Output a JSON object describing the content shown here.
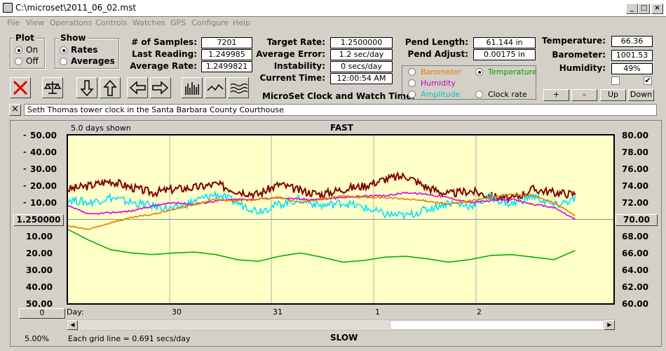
{
  "window": {
    "title": "C:\\microset\\2011_06_02.mst"
  },
  "menu": [
    "File",
    "View",
    "Operations",
    "Controls",
    "Watches",
    "GPS",
    "Configure",
    "Help"
  ],
  "plot_group": {
    "title": "Plot",
    "on": "On",
    "off": "Off",
    "selected": "On"
  },
  "show_group": {
    "title": "Show",
    "rates": "Rates",
    "averages": "Averages",
    "selected": "Rates"
  },
  "stats": {
    "samples_label": "# of Samples:",
    "samples": "7201",
    "last_label": "Last Reading:",
    "last": "1.249985",
    "avg_label": "Average Rate:",
    "avg": "1.2499821",
    "target_label": "Target Rate:",
    "target": "1.2500000",
    "err_label": "Average Error:",
    "err": "1.2 sec/day",
    "instab_label": "Instability:",
    "instab": "0 secs/day",
    "time_label": "Current Time:",
    "time": "12:00:54 AM",
    "pend_len_label": "Pend Length:",
    "pend_len": "61.144 in",
    "pend_adj_label": "Pend Adjust:",
    "pend_adj": "0.00175 in",
    "temp_label": "Temperature:",
    "temp": "66.36",
    "baro_label": "Barometer:",
    "baro": "1001.53",
    "hum_label": "Humidity:",
    "hum": "49%"
  },
  "app_title": "MicroSet Clock and Watch Timer",
  "sensor_options": [
    {
      "label": "Barometer",
      "color": "#e08000",
      "selected": false
    },
    {
      "label": "Temperature",
      "color": "#00a000",
      "selected": true
    },
    {
      "label": "Humidity",
      "color": "#c000c0",
      "selected": false
    },
    {
      "label": "Amplitude",
      "color": "#00c0c0",
      "selected": false
    },
    {
      "label": "Clock rate",
      "color": "#000000",
      "selected": false
    }
  ],
  "scale_buttons": {
    "plus": "+",
    "minus": "–",
    "up": "Up",
    "down": "Down"
  },
  "checkboxes": [
    {
      "checked": false
    },
    {
      "checked": true
    }
  ],
  "description": "Seth Thomas tower clock in the Santa Barbara County Courthouse",
  "chart": {
    "days_shown": "5.0 days shown",
    "fast_label": "FAST",
    "slow_label": "SLOW",
    "center_value": "1.250000",
    "right_center": "70.00",
    "offset_button": "0",
    "scale_pct": "5.00%",
    "grid_note": "Each grid line = 0.691 secs/day",
    "day_label": "Day:",
    "day_ticks": [
      "30",
      "31",
      "1",
      "2"
    ]
  },
  "chart_data": {
    "type": "line",
    "title": "FAST",
    "xlabel": "Day:",
    "ylabel": "",
    "x": [
      0,
      0.25,
      0.5,
      0.75,
      1,
      1.25,
      1.5,
      1.75,
      2,
      2.25,
      2.5,
      2.75,
      3,
      3.25,
      3.5,
      3.75,
      4,
      4.25,
      4.5,
      4.75,
      5
    ],
    "y_left_ticks": [
      "50.00",
      "40.00",
      "30.00",
      "20.00",
      "10.00",
      "1.250000",
      "10.00",
      "20.00",
      "30.00",
      "40.00",
      "50.00"
    ],
    "y_right_ticks": [
      "80.00",
      "78.00",
      "76.00",
      "74.00",
      "72.00",
      "70.00",
      "68.00",
      "66.00",
      "64.00",
      "62.00",
      "60.00"
    ],
    "ylim": [
      -50,
      50
    ],
    "grid": true,
    "series": [
      {
        "name": "Clock rate",
        "color": "#800000",
        "values": [
          18,
          20,
          23,
          19,
          16,
          18,
          19,
          21,
          17,
          15,
          21,
          17,
          15,
          18,
          20,
          24,
          26,
          19,
          15,
          17,
          14,
          12,
          18,
          16,
          15
        ]
      },
      {
        "name": "Amplitude",
        "color": "#00e0ff",
        "values": [
          12,
          10,
          13,
          10,
          8,
          6,
          11,
          15,
          10,
          5,
          9,
          12,
          8,
          10,
          7,
          3,
          2,
          6,
          10,
          8,
          13,
          9,
          14,
          8,
          12
        ]
      },
      {
        "name": "Humidity",
        "color": "#e000e0",
        "values": [
          8,
          3,
          4,
          5,
          8,
          10,
          9,
          11,
          12,
          12,
          13,
          12,
          12,
          13,
          14,
          14,
          16,
          15,
          13,
          10,
          11,
          12,
          9,
          7,
          0
        ]
      },
      {
        "name": "Barometer",
        "color": "#e08000",
        "values": [
          -4,
          -6,
          -2,
          1,
          3,
          6,
          9,
          12,
          11,
          12,
          13,
          10,
          12,
          14,
          13,
          13,
          12,
          11,
          9,
          11,
          13,
          15,
          14,
          10,
          2
        ]
      },
      {
        "name": "Temperature",
        "color": "#00b000",
        "values": [
          68.8,
          67.5,
          66.4,
          66.0,
          65.8,
          66.0,
          66.1,
          65.8,
          65.2,
          65.0,
          65.6,
          66.0,
          65.5,
          64.9,
          65.1,
          65.5,
          65.6,
          65.3,
          64.9,
          65.2,
          65.7,
          65.8,
          65.5,
          65.2,
          66.3
        ]
      }
    ]
  }
}
